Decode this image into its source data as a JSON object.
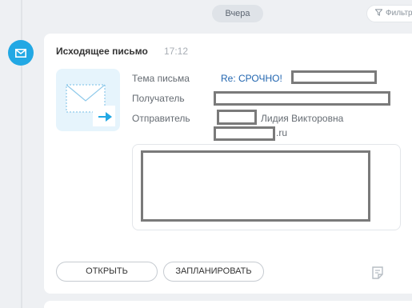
{
  "timeline": {
    "date_label": "Вчера",
    "filter_label": "Фильтр"
  },
  "activity": {
    "type_icon": "mail-icon",
    "title": "Исходящее письмо",
    "time": "17:12",
    "fields": {
      "subject_label": "Тема письма",
      "subject_value": "Re: СРОЧНО!",
      "recipient_label": "Получатель",
      "sender_label": "Отправитель",
      "sender_name": "Лидия Викторовна",
      "sender_domain": ".ru"
    },
    "buttons": {
      "open": "ОТКРЫТЬ",
      "schedule": "ЗАПЛАНИРОВАТЬ"
    }
  },
  "colors": {
    "accent": "#22a8e4",
    "link": "#2266b0",
    "background": "#eef0f3"
  }
}
